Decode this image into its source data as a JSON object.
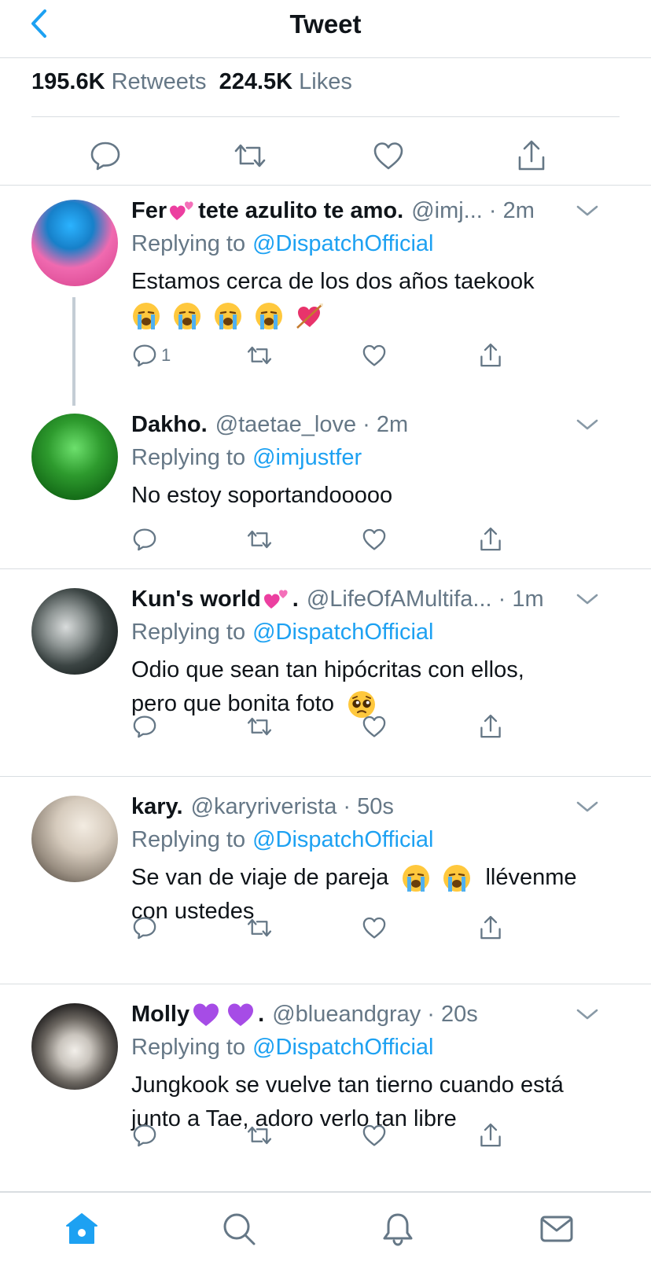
{
  "header": {
    "title": "Tweet"
  },
  "stats": {
    "retweets_count": "195.6K",
    "retweets_label": "Retweets",
    "likes_count": "224.5K",
    "likes_label": "Likes"
  },
  "colors": {
    "accent": "#1da1f2",
    "secondary_text": "#657786",
    "divider": "#d9dde1"
  },
  "replies": [
    {
      "name": "Fer",
      "name_emoji": "two-hearts",
      "name_suffix": "tete azulito te amo.",
      "handle": "@imj... · 2m",
      "replying_label": "Replying to",
      "replying_to": "@DispatchOfficial",
      "text": "Estamos cerca de los dos años taekook",
      "text_emojis": [
        "loudly-crying-face",
        "loudly-crying-face",
        "loudly-crying-face",
        "loudly-crying-face",
        "heart-with-arrow"
      ],
      "reply_count": "1"
    },
    {
      "name": "Dakho.",
      "handle": "@taetae_love · 2m",
      "replying_label": "Replying to",
      "replying_to": "@imjustfer",
      "text": "No estoy soportandooooo"
    },
    {
      "name": "Kun's world",
      "name_emoji": "two-hearts",
      "name_suffix": ".",
      "handle": "@LifeOfAMultifa... · 1m",
      "replying_label": "Replying to",
      "replying_to": "@DispatchOfficial",
      "text_line1": "Odio que sean tan hipócritas con ellos,",
      "text_line2": "pero que bonita foto",
      "text_emojis": [
        "pleading-face"
      ]
    },
    {
      "name": "kary.",
      "handle": "@karyriverista · 50s",
      "replying_label": "Replying to",
      "replying_to": "@DispatchOfficial",
      "text_part1": "Se van de viaje de pareja",
      "text_part2": "llévenme",
      "text_line2": "con ustedes",
      "text_emojis": [
        "loudly-crying-face",
        "loudly-crying-face"
      ]
    },
    {
      "name": "Molly",
      "name_emoji": "purple-heart",
      "name_suffix": ".",
      "handle": "@blueandgray · 20s",
      "replying_label": "Replying to",
      "replying_to": "@DispatchOfficial",
      "text_line1": "Jungkook se vuelve tan tierno cuando está",
      "text_line2": "junto a Tae, adoro verlo tan libre"
    }
  ],
  "tabbar": {
    "items": [
      "home-icon",
      "search-icon",
      "notifications-icon",
      "messages-icon"
    ],
    "active": "home-icon"
  }
}
